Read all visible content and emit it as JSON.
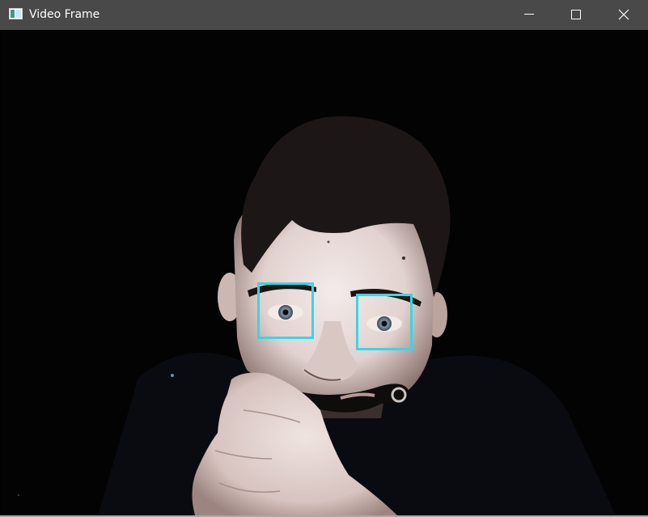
{
  "window": {
    "title": "Video Frame",
    "icon": "opencv-window-icon",
    "controls": {
      "minimize": "minimize-icon",
      "maximize": "maximize-icon",
      "close": "close-icon"
    }
  },
  "frame": {
    "detections": [
      {
        "label": "",
        "color": "#39d5e8"
      },
      {
        "label": "",
        "color": "#39d5e8"
      }
    ]
  }
}
